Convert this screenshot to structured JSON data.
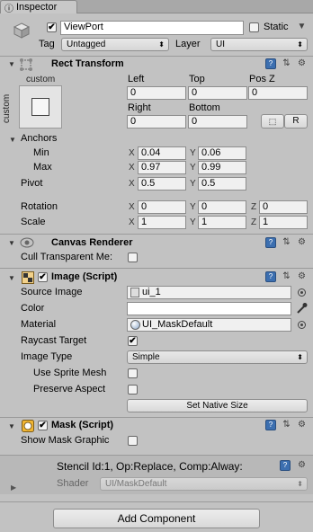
{
  "tab": {
    "label": "Inspector"
  },
  "object": {
    "name": "ViewPort",
    "static_label": "Static",
    "tag_label": "Tag",
    "tag_value": "Untagged",
    "layer_label": "Layer",
    "layer_value": "UI"
  },
  "rect_transform": {
    "title": "Rect Transform",
    "anchor_preset_top": "custom",
    "anchor_preset_side": "custom",
    "col_left": "Left",
    "col_top": "Top",
    "col_posz": "Pos Z",
    "val_left": "0",
    "val_top": "0",
    "val_posz": "0",
    "col_right": "Right",
    "col_bottom": "Bottom",
    "val_right": "0",
    "val_bottom": "0",
    "r_button": "R",
    "anchors_label": "Anchors",
    "min_label": "Min",
    "min_x": "0.04",
    "min_y": "0.06",
    "max_label": "Max",
    "max_x": "0.97",
    "max_y": "0.99",
    "pivot_label": "Pivot",
    "pivot_x": "0.5",
    "pivot_y": "0.5",
    "rotation_label": "Rotation",
    "rot_x": "0",
    "rot_y": "0",
    "rot_z": "0",
    "scale_label": "Scale",
    "scale_x": "1",
    "scale_y": "1",
    "scale_z": "1",
    "axis_x": "X",
    "axis_y": "Y",
    "axis_z": "Z"
  },
  "canvas_renderer": {
    "title": "Canvas Renderer",
    "cull_label": "Cull Transparent Me:"
  },
  "image": {
    "title": "Image (Script)",
    "source_label": "Source Image",
    "source_value": "ui_1",
    "color_label": "Color",
    "material_label": "Material",
    "material_value": "UI_MaskDefault",
    "raycast_label": "Raycast Target",
    "raycast_check": "✔",
    "type_label": "Image Type",
    "type_value": "Simple",
    "sprite_mesh_label": "Use Sprite Mesh",
    "preserve_label": "Preserve Aspect",
    "native_button": "Set Native Size"
  },
  "mask": {
    "title": "Mask (Script)",
    "show_graphic_label": "Show Mask Graphic"
  },
  "material_preview": {
    "stencil": "Stencil Id:1, Op:Replace, Comp:Alway:",
    "shader_label": "Shader",
    "shader_value": "UI/MaskDefault"
  },
  "add_component": {
    "label": "Add Component"
  },
  "colors": {
    "panel": "#c2c2c2",
    "header_bg": "#b8b8b8",
    "field_bg": "#f0f0f0"
  }
}
